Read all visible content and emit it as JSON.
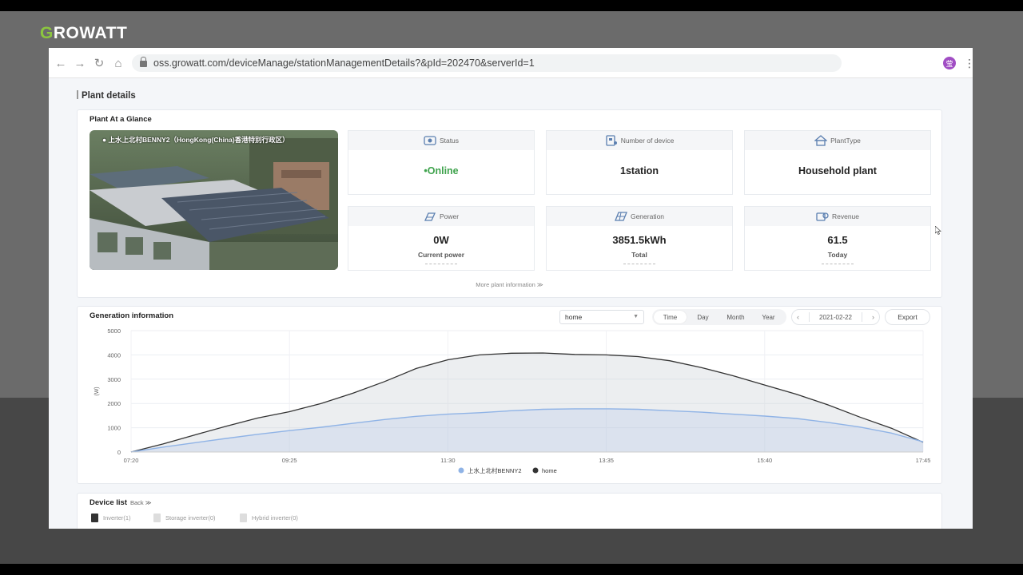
{
  "brand": {
    "first_letter": "G",
    "rest": "ROWATT"
  },
  "browser": {
    "url": "oss.growatt.com/deviceManage/stationManagementDetails?&pId=202470&serverId=1",
    "avatar": "莹"
  },
  "page": {
    "title": "Plant details"
  },
  "glance": {
    "title": "Plant At a Glance",
    "photo_label": "上水上北村BENNY2（HongKong(China)香港特别行政区）",
    "cards": {
      "status": {
        "label": "Status",
        "value": "•Online",
        "icon": "status-icon",
        "color": "#3fa34d"
      },
      "devices": {
        "label": "Number of device",
        "value": "1station",
        "icon": "device-icon"
      },
      "plant_type": {
        "label": "PlantType",
        "value": "Household plant",
        "icon": "house-icon"
      },
      "power": {
        "label": "Power",
        "value": "0W",
        "sub": "Current power",
        "icon": "power-icon"
      },
      "generation": {
        "label": "Generation",
        "value": "3851.5kWh",
        "sub": "Total",
        "icon": "solar-panel-icon"
      },
      "revenue": {
        "label": "Revenue",
        "value": "61.5",
        "sub": "Today",
        "icon": "revenue-icon"
      }
    },
    "more_info": "More plant information ≫"
  },
  "generation": {
    "title": "Generation information",
    "select_value": "home",
    "tabs": [
      "Time",
      "Day",
      "Month",
      "Year"
    ],
    "active_tab": "Time",
    "date": "2021-02-22",
    "export_label": "Export"
  },
  "chart_data": {
    "type": "area",
    "title": "",
    "xlabel": "",
    "ylabel": "(W)",
    "ylim": [
      0,
      5000
    ],
    "yticks": [
      0,
      1000,
      2000,
      3000,
      4000,
      5000
    ],
    "xtick_labels": [
      "07:20",
      "09:25",
      "11:30",
      "13:35",
      "15:40",
      "17:45"
    ],
    "x": [
      "07:20",
      "07:45",
      "08:10",
      "08:35",
      "09:00",
      "09:25",
      "09:50",
      "10:15",
      "10:40",
      "11:05",
      "11:30",
      "11:55",
      "12:20",
      "12:45",
      "13:10",
      "13:35",
      "14:00",
      "14:25",
      "14:50",
      "15:15",
      "15:40",
      "16:05",
      "16:30",
      "16:55",
      "17:20",
      "17:45"
    ],
    "series": [
      {
        "name": "上水上北村BENNY2",
        "color": "#8fb3e6",
        "values": [
          0,
          200,
          380,
          560,
          730,
          880,
          1020,
          1180,
          1340,
          1470,
          1560,
          1620,
          1700,
          1760,
          1780,
          1780,
          1760,
          1700,
          1640,
          1560,
          1480,
          1380,
          1220,
          1030,
          780,
          420
        ]
      },
      {
        "name": "home",
        "color": "#333333",
        "values": [
          0,
          330,
          700,
          1060,
          1400,
          1660,
          2000,
          2420,
          2900,
          3440,
          3800,
          4000,
          4070,
          4080,
          4020,
          4000,
          3930,
          3760,
          3480,
          3140,
          2760,
          2380,
          1940,
          1440,
          980,
          400
        ]
      }
    ],
    "legend_position": "bottom"
  },
  "devices": {
    "title": "Device list",
    "back_label": "Back ≫",
    "tabs": [
      "Inverter(1)",
      "Storage inverter(0)",
      "Hybrid inverter(0)"
    ]
  }
}
